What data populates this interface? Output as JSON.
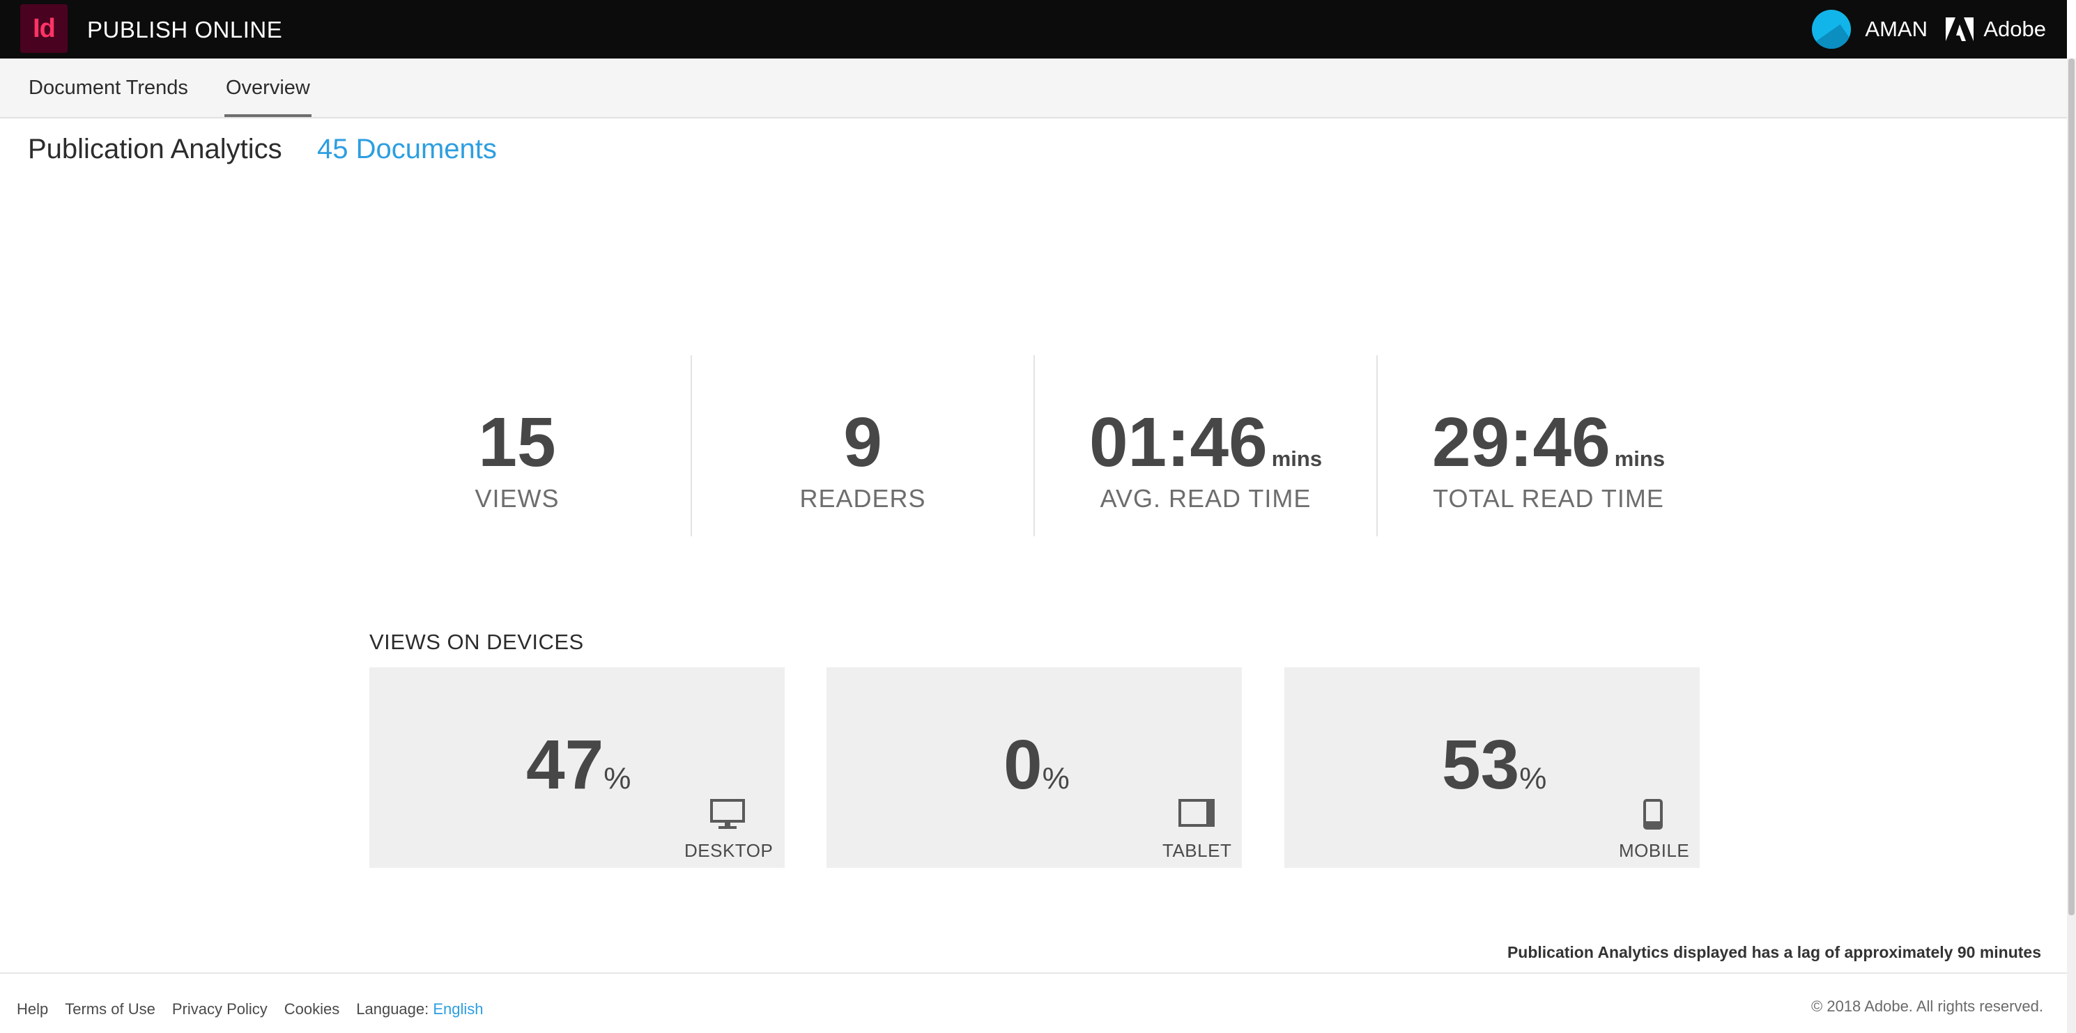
{
  "app": {
    "logo_text": "Id",
    "title": "PUBLISH ONLINE",
    "user_name": "AMAN",
    "brand": "Adobe"
  },
  "tabs": [
    {
      "label": "Document Trends",
      "active": false
    },
    {
      "label": "Overview",
      "active": true
    }
  ],
  "header": {
    "title": "Publication Analytics",
    "documents_link": "45 Documents"
  },
  "stats": [
    {
      "value": "15",
      "unit": "",
      "label": "VIEWS"
    },
    {
      "value": "9",
      "unit": "",
      "label": "READERS"
    },
    {
      "value": "01:46",
      "unit": "mins",
      "label": "AVG. READ TIME"
    },
    {
      "value": "29:46",
      "unit": "mins",
      "label": "TOTAL READ TIME"
    }
  ],
  "devices": {
    "heading": "VIEWS ON DEVICES",
    "items": [
      {
        "value": "47",
        "pct": "%",
        "label": "DESKTOP",
        "icon": "desktop-icon"
      },
      {
        "value": "0",
        "pct": "%",
        "label": "TABLET",
        "icon": "tablet-icon"
      },
      {
        "value": "53",
        "pct": "%",
        "label": "MOBILE",
        "icon": "mobile-icon"
      }
    ]
  },
  "footer": {
    "lag_note": "Publication Analytics displayed has a lag of approximately 90 minutes",
    "links": [
      "Help",
      "Terms of Use",
      "Privacy Policy",
      "Cookies"
    ],
    "language_label": "Language:",
    "language_value": "English",
    "copyright": "© 2018 Adobe. All rights reserved."
  },
  "colors": {
    "appbar": "#0c0c0c",
    "accent_link": "#2d9ee0",
    "logo_bg": "#49021f",
    "logo_fg": "#ff3366",
    "card_bg": "#efefef"
  }
}
